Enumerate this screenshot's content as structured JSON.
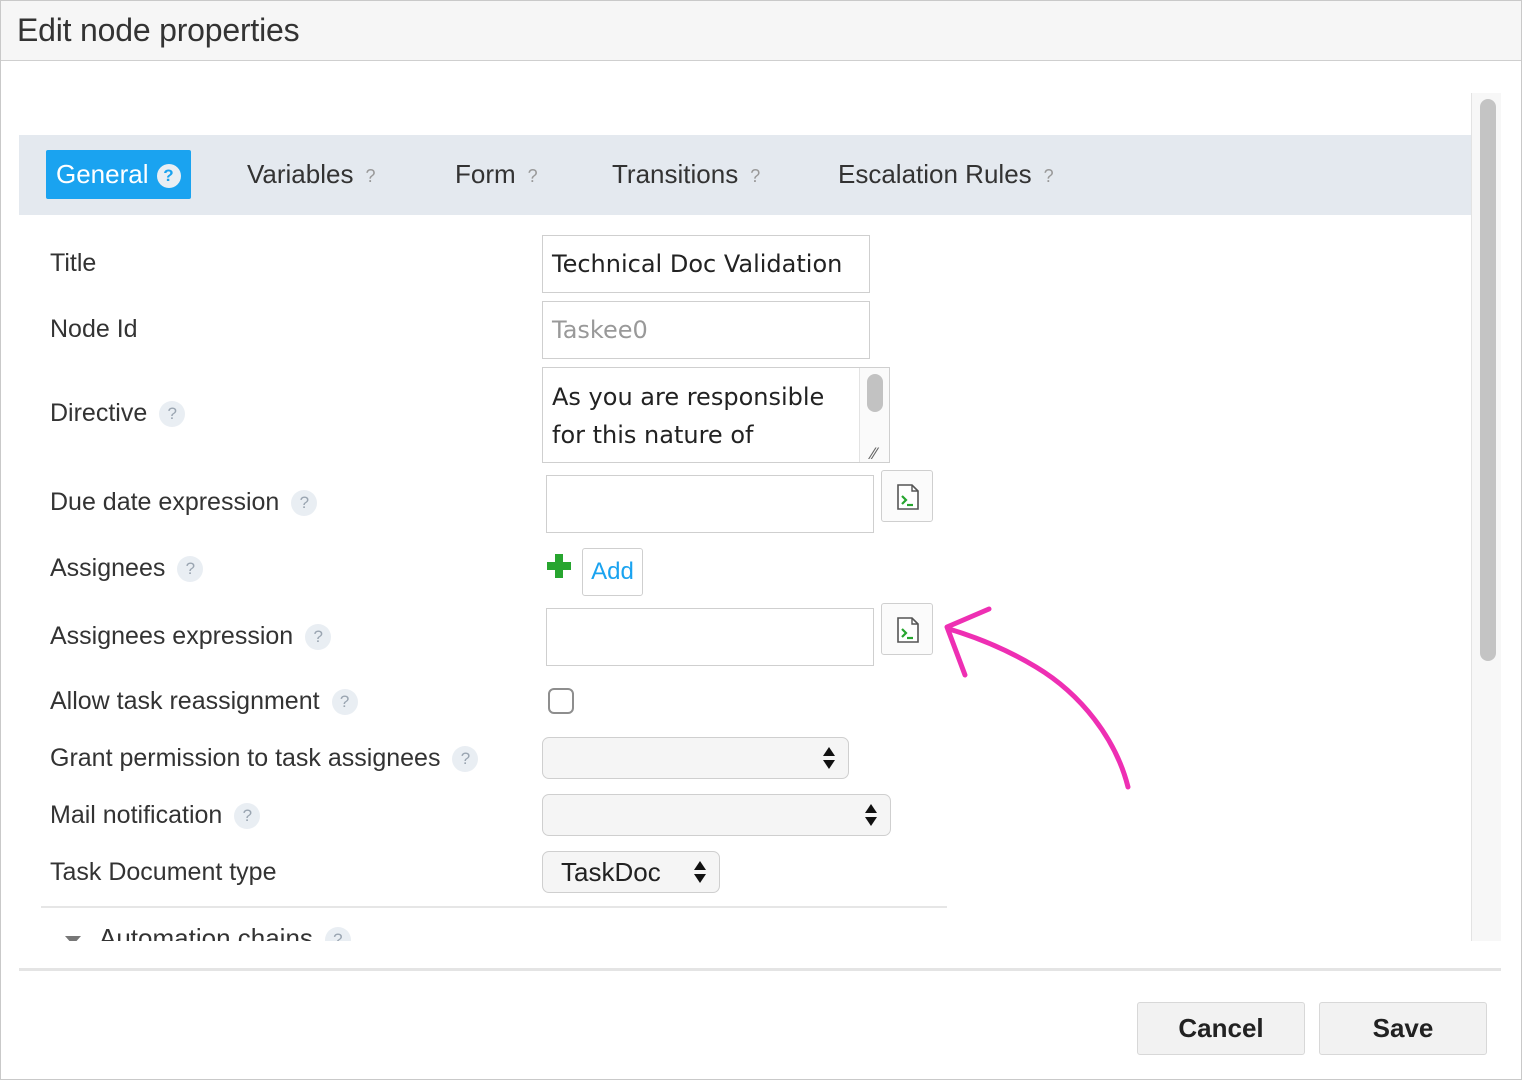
{
  "dialog": {
    "title": "Edit node properties"
  },
  "tabs": [
    {
      "label": "General",
      "help": "?",
      "active": true
    },
    {
      "label": "Variables",
      "help": "?",
      "active": false
    },
    {
      "label": "Form",
      "help": "?",
      "active": false
    },
    {
      "label": "Transitions",
      "help": "?",
      "active": false
    },
    {
      "label": "Escalation Rules",
      "help": "?",
      "active": false
    }
  ],
  "form": {
    "title": {
      "label": "Title",
      "value": "Technical Doc Validation"
    },
    "node_id": {
      "label": "Node Id",
      "value": "Taskee0"
    },
    "directive": {
      "label": "Directive",
      "help": "?",
      "value": "As you are responsible for this nature of"
    },
    "due_date_expression": {
      "label": "Due date expression",
      "help": "?",
      "value": ""
    },
    "assignees": {
      "label": "Assignees",
      "help": "?",
      "add_label": "Add"
    },
    "assignees_expression": {
      "label": "Assignees expression",
      "help": "?",
      "value": ""
    },
    "allow_reassignment": {
      "label": "Allow task reassignment",
      "help": "?",
      "checked": false
    },
    "grant_permission": {
      "label": "Grant permission to task assignees",
      "help": "?",
      "value": ""
    },
    "mail_notification": {
      "label": "Mail notification",
      "help": "?",
      "value": ""
    },
    "task_doc_type": {
      "label": "Task Document type",
      "value": "TaskDoc"
    },
    "automation_chains": {
      "label": "Automation chains",
      "help": "?"
    }
  },
  "footer": {
    "cancel_label": "Cancel",
    "save_label": "Save"
  },
  "icons": {
    "expression": "expression-editor-icon",
    "add": "plus-icon"
  },
  "colors": {
    "accent": "#1aa3f0",
    "add_green": "#27a52f",
    "annotation": "#ee2fb3"
  }
}
